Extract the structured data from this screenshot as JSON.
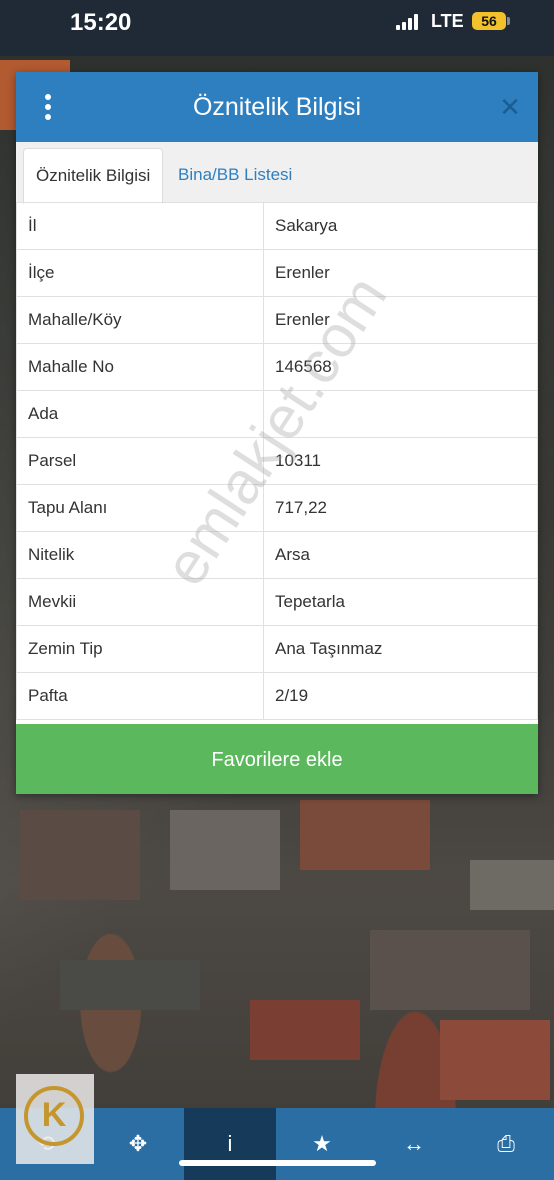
{
  "status_bar": {
    "time": "15:20",
    "network": "LTE",
    "battery": "56",
    "battery_color": "#f3c12c"
  },
  "dialog": {
    "title": "Öznitelik Bilgisi",
    "menu_icon": "vertical-dots-icon",
    "close_icon": "close-icon",
    "header_color": "#2e7fc0",
    "tabs": [
      {
        "label": "Öznitelik Bilgisi",
        "active": true
      },
      {
        "label": "Bina/BB Listesi",
        "active": false
      }
    ],
    "rows": [
      {
        "key": "İl",
        "value": "Sakarya"
      },
      {
        "key": "İlçe",
        "value": "Erenler"
      },
      {
        "key": "Mahalle/Köy",
        "value": "Erenler"
      },
      {
        "key": "Mahalle No",
        "value": "146568"
      },
      {
        "key": "Ada",
        "value": ""
      },
      {
        "key": "Parsel",
        "value": "10311"
      },
      {
        "key": "Tapu Alanı",
        "value": "717,22"
      },
      {
        "key": "Nitelik",
        "value": "Arsa"
      },
      {
        "key": "Mevkii",
        "value": "Tepetarla"
      },
      {
        "key": "Zemin Tip",
        "value": "Ana Taşınmaz"
      },
      {
        "key": "Pafta",
        "value": "2/19"
      }
    ],
    "favorite_button": "Favorilere ekle",
    "favorite_color": "#5cb85c"
  },
  "watermark": "emlakjet.com",
  "bottom_bar": {
    "items": [
      {
        "icon": "layers-icon",
        "active": false
      },
      {
        "icon": "move-icon",
        "active": false
      },
      {
        "icon": "info-icon",
        "active": true
      },
      {
        "icon": "star-icon",
        "active": false
      },
      {
        "icon": "measure-icon",
        "active": false
      },
      {
        "icon": "print-icon",
        "active": false
      }
    ]
  }
}
